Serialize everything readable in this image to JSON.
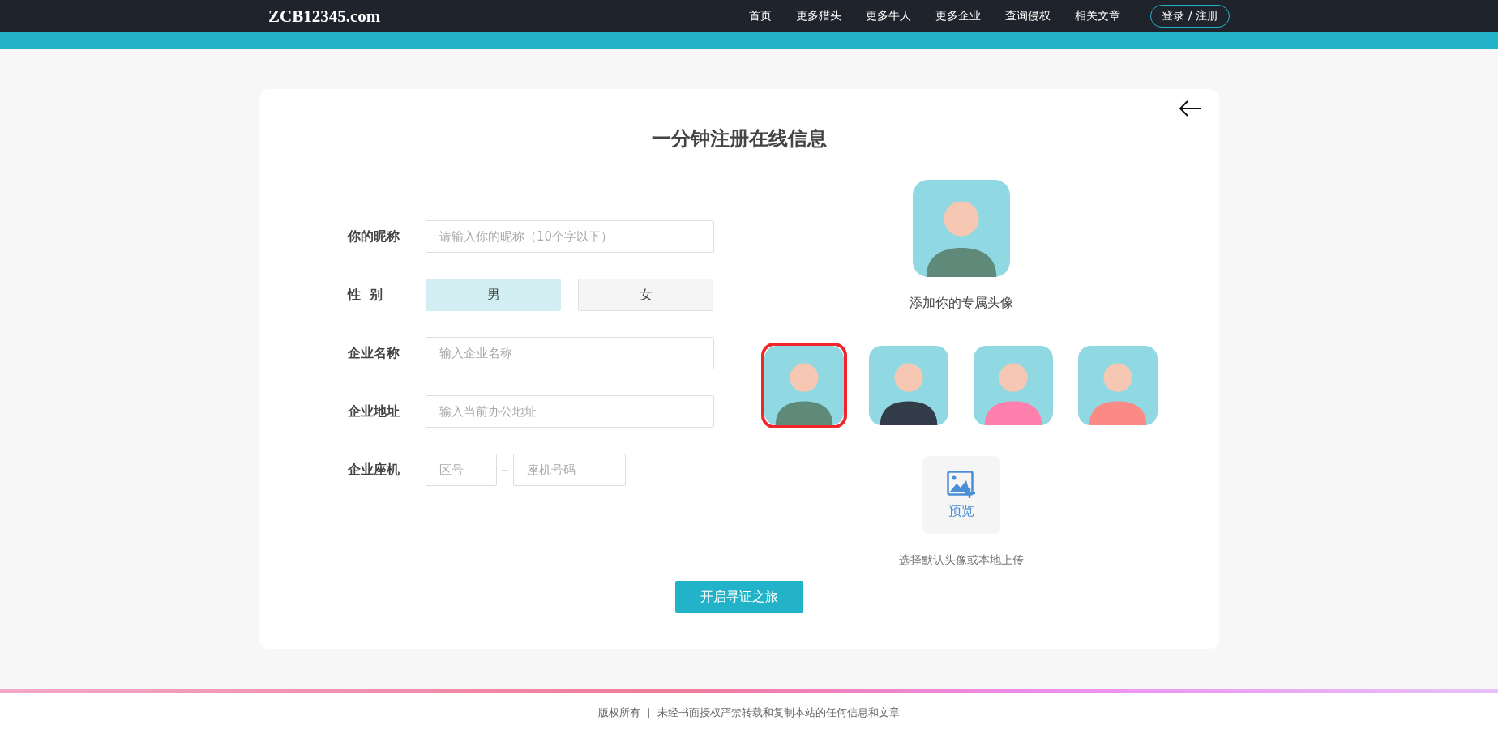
{
  "header": {
    "logo": "ZCB12345.com",
    "nav": [
      {
        "label": "首页"
      },
      {
        "label": "更多猎头"
      },
      {
        "label": "更多牛人"
      },
      {
        "label": "更多企业"
      },
      {
        "label": "查询侵权"
      },
      {
        "label": "相关文章"
      }
    ],
    "login": "登录 / 注册"
  },
  "form": {
    "title": "一分钟注册在线信息",
    "nickname": {
      "label": "你的昵称",
      "placeholder": "请输入你的昵称（10个字以下）"
    },
    "gender": {
      "label": "性  别",
      "options": [
        {
          "label": "男",
          "selected": true
        },
        {
          "label": "女",
          "selected": false
        }
      ]
    },
    "company_name": {
      "label": "企业名称",
      "placeholder": "输入企业名称"
    },
    "company_address": {
      "label": "企业地址",
      "placeholder": "输入当前办公地址"
    },
    "landline": {
      "label": "企业座机",
      "area_placeholder": "区号",
      "number_placeholder": "座机号码"
    },
    "submit": "开启寻证之旅"
  },
  "avatar": {
    "caption": "添加你的专属头像",
    "options": [
      {
        "color": "#5f8a7a",
        "selected": true
      },
      {
        "color": "#333a48",
        "selected": false
      },
      {
        "color": "#ff80ad",
        "selected": false
      },
      {
        "color": "#fb8a86",
        "selected": false
      }
    ],
    "upload_label": "预览",
    "hint": "选择默认头像或本地上传"
  },
  "footer": {
    "text": "版权所有 ｜ 未经书面授权严禁转载和复制本站的任何信息和文章"
  }
}
